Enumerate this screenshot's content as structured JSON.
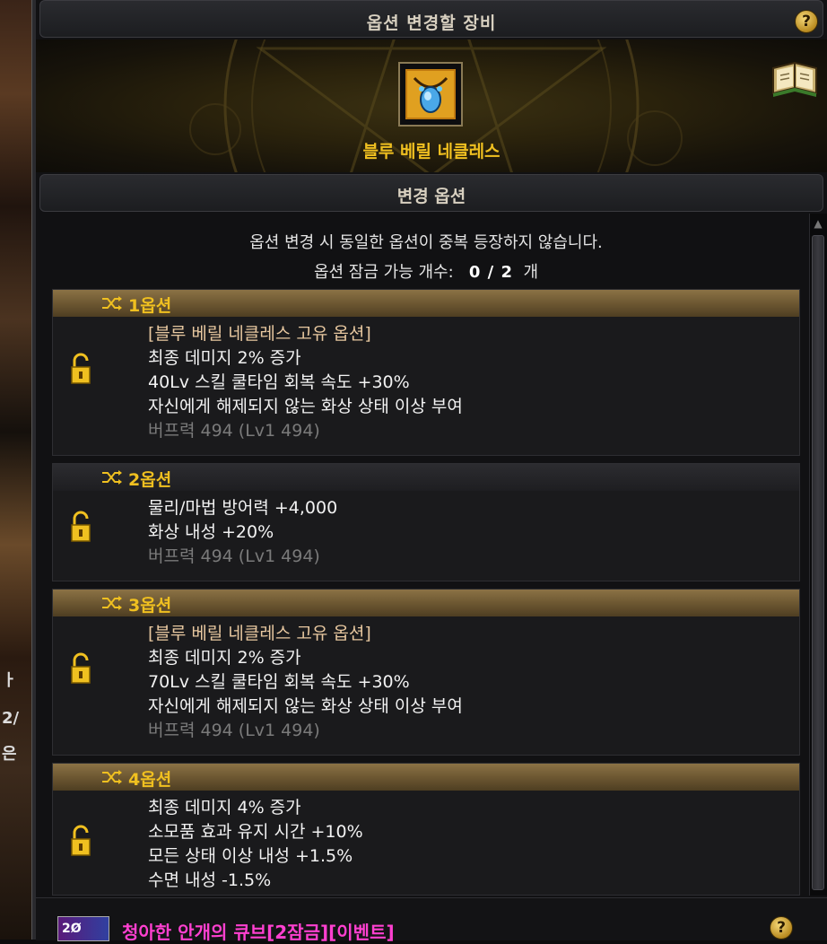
{
  "window": {
    "title": "옵션 변경할 장비"
  },
  "left_strip": {
    "texts": [
      "ㅏ",
      "2/",
      "은"
    ]
  },
  "item": {
    "name": "블루 베릴 네클레스",
    "icon": "necklace-icon"
  },
  "section": {
    "title": "변경 옵션"
  },
  "notice": {
    "line1": "옵션 변경 시 동일한 옵션이 중복 등장하지 않습니다.",
    "lock_label": "옵션 잠금 가능 개수:",
    "lock_count": "0 / 2",
    "lock_unit": "개"
  },
  "options": [
    {
      "label": "1옵션",
      "lines": [
        {
          "text": "[블루 베릴 네클레스 고유 옵션]",
          "kind": "unique"
        },
        {
          "text": "최종 데미지 2% 증가",
          "kind": "normal"
        },
        {
          "text": "40Lv 스킬 쿨타임 회복 속도 +30%",
          "kind": "normal"
        },
        {
          "text": "자신에게 해제되지 않는 화상 상태 이상 부여",
          "kind": "normal"
        },
        {
          "text": "버프력 494 (Lv1 494)",
          "kind": "buff"
        }
      ]
    },
    {
      "label": "2옵션",
      "lines": [
        {
          "text": "물리/마법 방어력 +4,000",
          "kind": "normal"
        },
        {
          "text": "화상 내성 +20%",
          "kind": "normal"
        },
        {
          "text": "버프력 494 (Lv1 494)",
          "kind": "buff"
        }
      ]
    },
    {
      "label": "3옵션",
      "lines": [
        {
          "text": "[블루 베릴 네클레스 고유 옵션]",
          "kind": "unique"
        },
        {
          "text": "최종 데미지 2% 증가",
          "kind": "normal"
        },
        {
          "text": "70Lv 스킬 쿨타임 회복 속도 +30%",
          "kind": "normal"
        },
        {
          "text": "자신에게 해제되지 않는 화상 상태 이상 부여",
          "kind": "normal"
        },
        {
          "text": "버프력 494 (Lv1 494)",
          "kind": "buff"
        }
      ]
    },
    {
      "label": "4옵션",
      "lines": [
        {
          "text": "최종 데미지 4% 증가",
          "kind": "normal"
        },
        {
          "text": "소모품 효과 유지 시간 +10%",
          "kind": "normal"
        },
        {
          "text": "모든 상태 이상 내성 +1.5%",
          "kind": "normal"
        },
        {
          "text": "수면 내성 -1.5%",
          "kind": "normal"
        }
      ]
    }
  ],
  "bottom": {
    "cube_badge": "2Ø",
    "cube_name": "청아한 안개의 큐브[2잠금][이벤트]",
    "help": "?"
  },
  "help": "?",
  "colors": {
    "accent_gold": "#f0c020",
    "item_name": "#f0c020",
    "cube_name": "#ff40d0",
    "buff_text": "#7a7a7a"
  }
}
